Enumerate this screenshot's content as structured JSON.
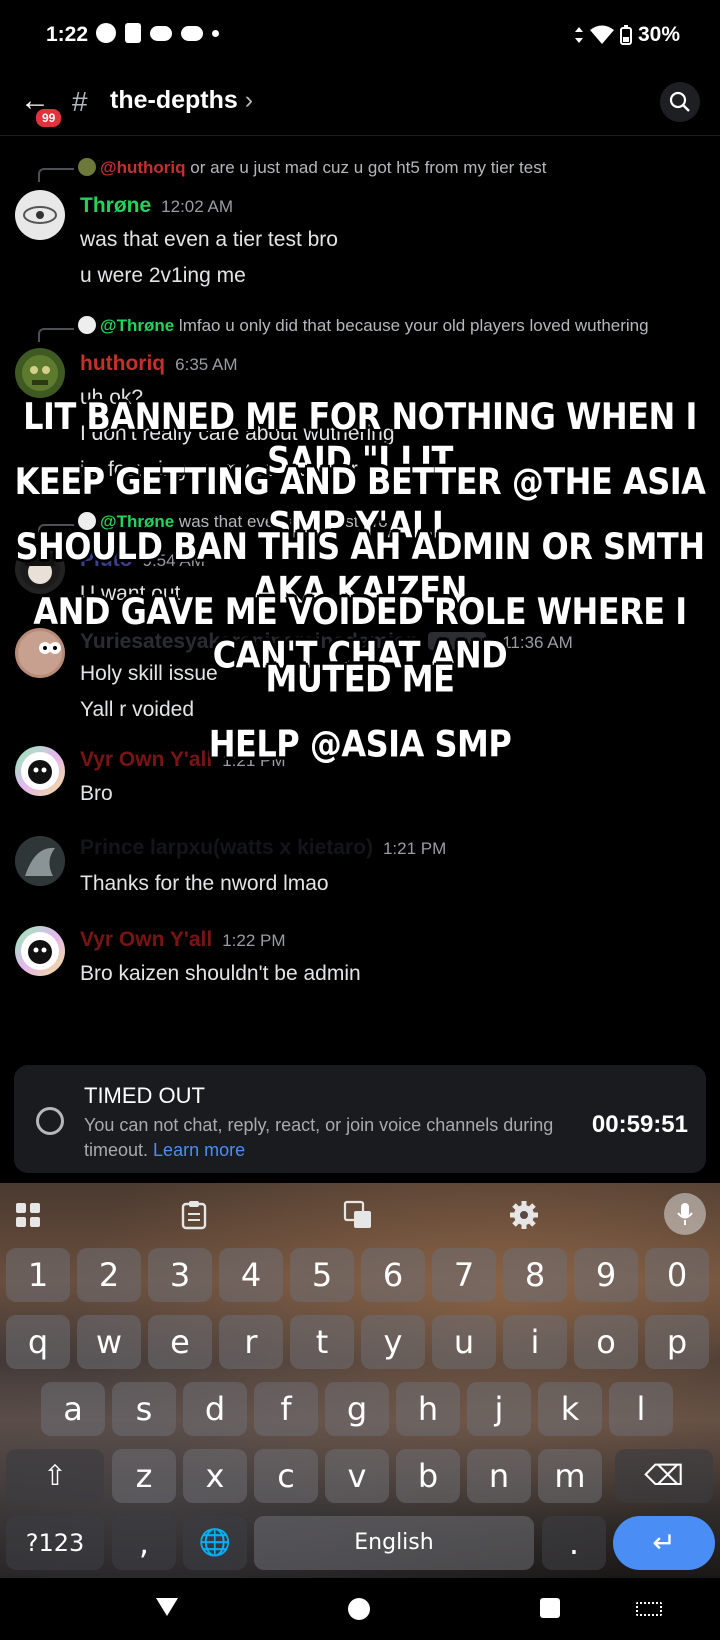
{
  "status_bar": {
    "time": "1:22",
    "battery": "30%"
  },
  "header": {
    "unread_badge": "99",
    "channel_name": "the-depths",
    "chevron": "›"
  },
  "messages": [
    {
      "reply_to": "@huthoriq",
      "reply_text": "or are u just mad cuz u got ht5 from my tier test",
      "author": "Thrøne",
      "author_color": "#23d35a",
      "time": "12:02 AM",
      "lines": [
        "was that even a tier test bro",
        "u were 2v1ing me"
      ]
    },
    {
      "reply_to": "@Thrøne",
      "reply_text": "lmfao u only did that because your old players loved wuthering",
      "author": "huthoriq",
      "author_color": "#c4302b",
      "time": "6:35 AM",
      "lines": [
        "uh ok?",
        "I don't really care about wuthering",
        "im focusing on my own server"
      ]
    },
    {
      "reply_to": "@Thrøne",
      "reply_text": "was that even a tier test bro",
      "author": "Pluto",
      "author_color": "#3b3f8a",
      "time": "9:54 AM",
      "lines": [
        "U want out"
      ]
    },
    {
      "author": "Yuriesatesyakaraninarainadamien",
      "author_color": "#2a2c33",
      "time": "11:36 AM",
      "lines": [
        "Holy skill issue",
        "Yall r voided"
      ]
    },
    {
      "author": "Vyr Own Y'all",
      "author_color": "#7a1414",
      "time": "1:21 PM",
      "lines": [
        "Bro"
      ]
    },
    {
      "author": "Prince larpxu(watts x kietaro)",
      "author_color": "#14151a",
      "time": "1:21 PM",
      "lines": [
        "Thanks for the nword lmao"
      ]
    },
    {
      "author": "Vyr Own Y'all",
      "author_color": "#7a1414",
      "time": "1:22 PM",
      "lines": [
        "Bro kaizen shouldn't be admin"
      ]
    }
  ],
  "overlay_text": [
    "LIT BANNED ME FOR NOTHING WHEN I SAID \"I LIT",
    "KEEP GETTING AND BETTER @THE ASIA SMP Y'ALL",
    "SHOULD BAN THIS AH ADMIN OR SMTH AKA KAIZEN",
    "AND GAVE ME VOIDED ROLE WHERE I CAN'T CHAT AND",
    "MUTED ME",
    "HELP @ASIA SMP"
  ],
  "timeout": {
    "title": "TIMED OUT",
    "description": "You can not chat, reply, react, or join voice channels during timeout.",
    "learn_more": "Learn more",
    "timer": "00:59:51"
  },
  "keyboard": {
    "number_row": [
      "1",
      "2",
      "3",
      "4",
      "5",
      "6",
      "7",
      "8",
      "9",
      "0"
    ],
    "row1": [
      "q",
      "w",
      "e",
      "r",
      "t",
      "y",
      "u",
      "i",
      "o",
      "p"
    ],
    "row2": [
      "a",
      "s",
      "d",
      "f",
      "g",
      "h",
      "j",
      "k",
      "l"
    ],
    "row3": [
      "z",
      "x",
      "c",
      "v",
      "b",
      "n",
      "m"
    ],
    "symbols_key": "?123",
    "comma_key": ",",
    "space_label": "English",
    "period_key": ".",
    "shift_icon": "⇧",
    "backspace_icon": "⌫",
    "enter_icon": "↵",
    "globe_icon": "🌐"
  }
}
